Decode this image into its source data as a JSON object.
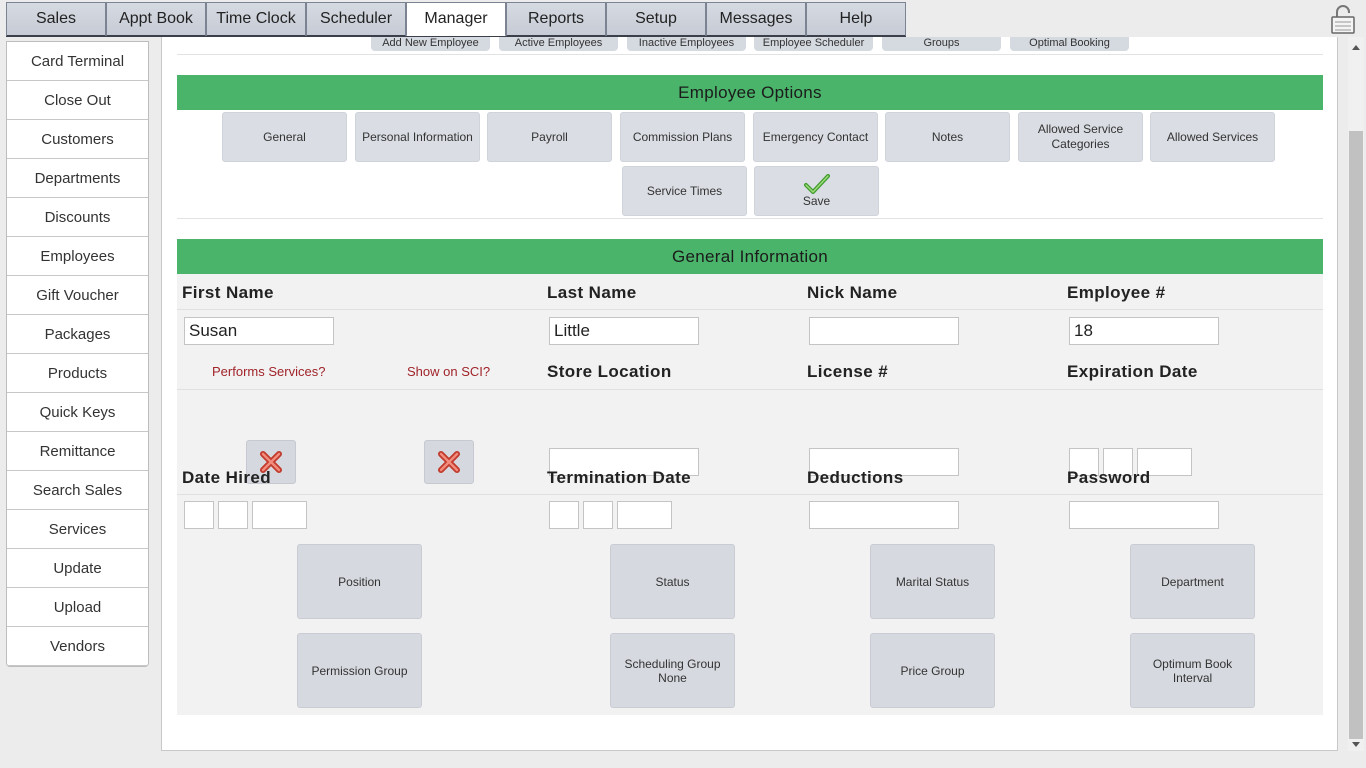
{
  "top_tabs": [
    "Sales",
    "Appt Book",
    "Time Clock",
    "Scheduler",
    "Manager",
    "Reports",
    "Setup",
    "Messages",
    "Help"
  ],
  "active_tab": "Manager",
  "sidebar": [
    "Card Terminal",
    "Close Out",
    "Customers",
    "Departments",
    "Discounts",
    "Employees",
    "Gift Voucher",
    "Packages",
    "Products",
    "Quick Keys",
    "Remittance",
    "Search Sales",
    "Services",
    "Update",
    "Upload",
    "Vendors"
  ],
  "subtabs": [
    "Add New Employee",
    "Active Employees",
    "Inactive Employees",
    "Employee Scheduler",
    "Groups",
    "Optimal Booking"
  ],
  "employee_options": {
    "title": "Employee Options",
    "buttons": [
      "General",
      "Personal Information",
      "Payroll",
      "Commission Plans",
      "Emergency Contact",
      "Notes",
      "Allowed Service Categories",
      "Allowed Services"
    ],
    "service_times": "Service Times",
    "save": "Save"
  },
  "general": {
    "title": "General Information",
    "first_name_label": "First Name",
    "first_name": "Susan",
    "last_name_label": "Last Name",
    "last_name": "Little",
    "nick_name_label": "Nick Name",
    "nick_name": "",
    "employee_no_label": "Employee #",
    "employee_no": "18",
    "performs_services_label": "Performs Services?",
    "show_on_sci_label": "Show on SCI?",
    "store_location_label": "Store Location",
    "store_location": "",
    "license_label": "License #",
    "license": "",
    "expiration_label": "Expiration Date",
    "date_hired_label": "Date Hired",
    "termination_label": "Termination Date",
    "deductions_label": "Deductions",
    "deductions": "",
    "password_label": "Password",
    "password": "",
    "position": "Position",
    "status": "Status",
    "marital_status": "Marital Status",
    "department": "Department",
    "permission_group": "Permission Group",
    "scheduling_group": "Scheduling Group",
    "scheduling_group_value": "None",
    "price_group": "Price Group",
    "optimum_book_interval": "Optimum Book Interval"
  },
  "colors": {
    "section_green": "#4ab46a",
    "button_gray": "#dadde3",
    "red_label": "#a0242a"
  }
}
